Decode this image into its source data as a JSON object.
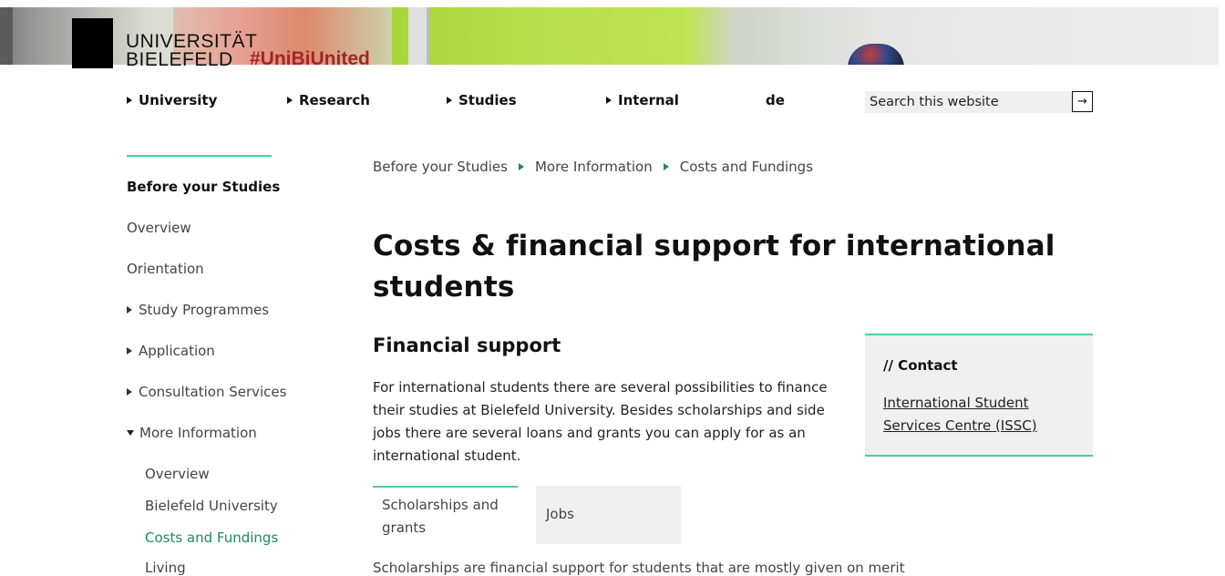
{
  "header": {
    "logo_line1": "UNIVERSITÄT",
    "logo_line2": "BIELEFELD",
    "hashtag": "#UniBiUnited"
  },
  "nav": {
    "items": [
      {
        "label": "University"
      },
      {
        "label": "Research"
      },
      {
        "label": "Studies"
      },
      {
        "label": "Internal"
      }
    ],
    "language": "de",
    "search": {
      "placeholder": "Search this website",
      "button_icon": "arrow-right-icon",
      "button_glyph": "→"
    }
  },
  "sidebar": {
    "section_title": "Before your Studies",
    "items": [
      {
        "label": "Overview"
      },
      {
        "label": "Orientation"
      },
      {
        "label": "Study Programmes"
      },
      {
        "label": "Application"
      },
      {
        "label": "Consultation Services"
      },
      {
        "label": "More Information"
      }
    ],
    "subitems": [
      {
        "label": "Overview"
      },
      {
        "label": "Bielefeld University"
      },
      {
        "label": "Costs and Fundings"
      },
      {
        "label": "Living"
      }
    ]
  },
  "breadcrumb": [
    "Before your Studies",
    "More Information",
    "Costs and Fundings"
  ],
  "main": {
    "title": "Costs & financial support for international students",
    "section_heading": "Financial support",
    "intro": "For international students there are several possibilities to finance their studies at Bielefeld University. Besides scholarships and side jobs there are several loans and grants you can apply for as an international student.",
    "tabs": [
      {
        "label": "Scholarships and grants"
      },
      {
        "label": "Jobs"
      }
    ],
    "cut_text": "Scholarships are financial support for students that are mostly given on merit"
  },
  "contact": {
    "heading": "// Contact",
    "link": "International Student Services Centre (ISSC)"
  },
  "colors": {
    "accent": "#3ed2a7",
    "active_link": "#1c8a5e",
    "hashtag": "#a3262b"
  }
}
